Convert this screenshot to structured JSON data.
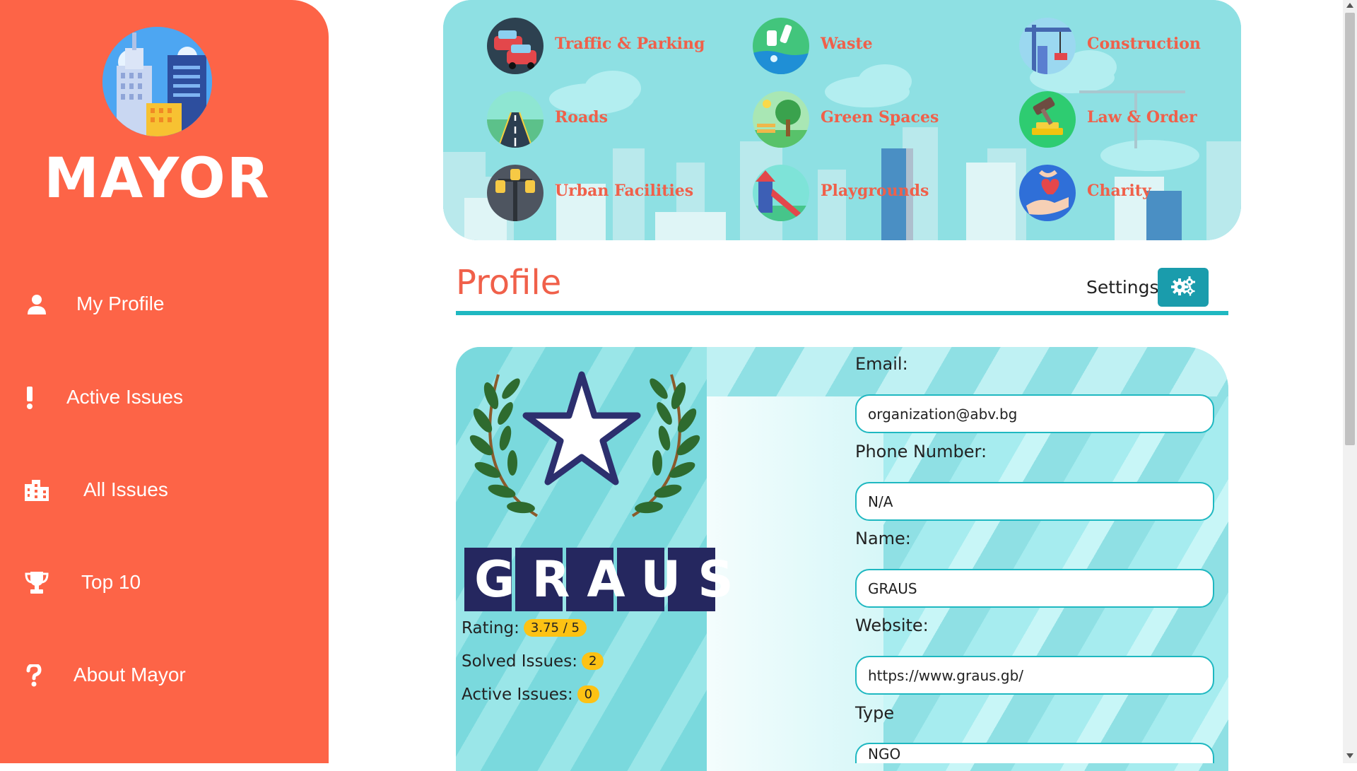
{
  "sidebar": {
    "brand": "MAYOR",
    "items": [
      {
        "label": "My Profile",
        "icon": "user-icon"
      },
      {
        "label": "Active Issues",
        "icon": "exclamation-icon"
      },
      {
        "label": "All Issues",
        "icon": "city-icon"
      },
      {
        "label": "Top 10",
        "icon": "trophy-icon"
      },
      {
        "label": "About Mayor",
        "icon": "question-icon"
      }
    ]
  },
  "categories": [
    {
      "label": "Traffic & Parking",
      "icon": "cars-icon"
    },
    {
      "label": "Waste",
      "icon": "waste-icon"
    },
    {
      "label": "Construction",
      "icon": "crane-icon"
    },
    {
      "label": "Roads",
      "icon": "road-icon"
    },
    {
      "label": "Green Spaces",
      "icon": "tree-icon"
    },
    {
      "label": "Law & Order",
      "icon": "gavel-icon"
    },
    {
      "label": "Urban Facilities",
      "icon": "streetlamp-icon"
    },
    {
      "label": "Playgrounds",
      "icon": "slide-icon"
    },
    {
      "label": "Charity",
      "icon": "heart-hand-icon"
    }
  ],
  "profile": {
    "title": "Profile",
    "settings_label": "Settings",
    "org_name": "GRAUS",
    "rating_label": "Rating:",
    "rating_value": "3.75 / 5",
    "solved_label": "Solved Issues:",
    "solved_value": "2",
    "active_label": "Active Issues:",
    "active_value": "0"
  },
  "fields": {
    "email_label": "Email:",
    "email_value": "organization@abv.bg",
    "phone_label": "Phone Number:",
    "phone_value": "N/A",
    "name_label": "Name:",
    "name_value": "GRAUS",
    "website_label": "Website:",
    "website_value": "https://www.graus.gb/",
    "type_label": "Type",
    "type_value": "NGO"
  },
  "colors": {
    "sidebar": "#fd6447",
    "accent": "#1fb8c1",
    "category_text": "#f0604a",
    "badge": "#fdc214",
    "banner": "#8ee0e3"
  }
}
